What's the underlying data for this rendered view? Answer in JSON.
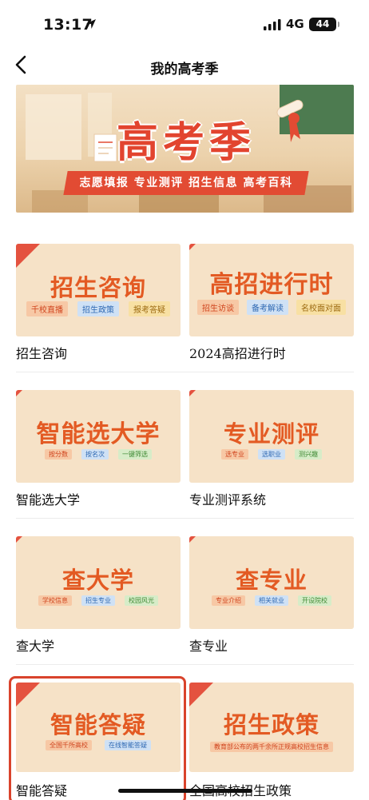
{
  "status_bar": {
    "time": "13:17",
    "network": "4G",
    "battery": "44"
  },
  "nav": {
    "title": "我的高考季"
  },
  "banner": {
    "headline": "高考季",
    "slogan": "志愿填报  专业测评  招生信息  高考百科"
  },
  "cards": [
    {
      "title": "招生咨询",
      "tags": [
        "千校直播",
        "招生政策",
        "报考答疑"
      ],
      "caption": "招生咨询"
    },
    {
      "title": "高招进行时",
      "tags": [
        "招生访谈",
        "备考解读",
        "名校面对面"
      ],
      "caption": "2024高招进行时"
    },
    {
      "title": "智能选大学",
      "tags": [
        "按分数",
        "按名次",
        "一键筛选"
      ],
      "caption": "智能选大学"
    },
    {
      "title": "专业测评",
      "tags": [
        "选专业",
        "选职业",
        "测兴趣"
      ],
      "caption": "专业测评系统"
    },
    {
      "title": "查大学",
      "tags": [
        "学校信息",
        "招生专业",
        "校园风光"
      ],
      "caption": "查大学"
    },
    {
      "title": "查专业",
      "tags": [
        "专业介绍",
        "相关就业",
        "开设院校"
      ],
      "caption": "查专业"
    },
    {
      "title": "智能答疑",
      "tags": [
        "全国千所高校",
        "在线智能答疑"
      ],
      "caption": "智能答疑"
    },
    {
      "title": "招生政策",
      "tags": [
        "教育部公布的两千余所正规高校招生信息"
      ],
      "caption": "全国高校招生政策"
    }
  ],
  "colors": {
    "accent": "#e35a23",
    "selection": "#d9432c",
    "card_bg": "#f6e2c7"
  }
}
